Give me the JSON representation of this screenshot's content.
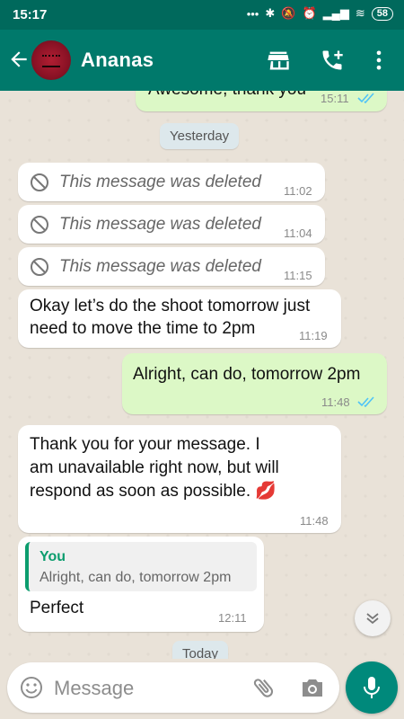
{
  "status_bar": {
    "time": "15:17",
    "battery": "58"
  },
  "header": {
    "contact_name": "Ananas"
  },
  "date_chips": {
    "yesterday": "Yesterday",
    "today": "Today"
  },
  "messages": [
    {
      "dir": "out",
      "text": "Awesome, thank you",
      "time": "15:11"
    },
    {
      "dir": "in",
      "deleted": true,
      "text": "This message was deleted",
      "time": "11:02"
    },
    {
      "dir": "in",
      "deleted": true,
      "text": "This message was deleted",
      "time": "11:04"
    },
    {
      "dir": "in",
      "deleted": true,
      "text": "This message was deleted",
      "time": "11:15"
    },
    {
      "dir": "in",
      "line1": "Okay let’s do the shoot tomorrow just",
      "line2": "need to move the time to 2pm",
      "time": "11:19"
    },
    {
      "dir": "out",
      "text": "Alright, can do, tomorrow 2pm",
      "time": "11:48"
    },
    {
      "dir": "in",
      "line1": "Thank you for your message. I",
      "line2": "am unavailable right now, but will",
      "line3": "respond as soon as possible. 💋",
      "time": "11:48"
    },
    {
      "dir": "in",
      "reply_author": "You",
      "reply_text": "Alright, can do, tomorrow 2pm",
      "text": "Perfect",
      "time": "12:11"
    }
  ],
  "composer": {
    "placeholder": "Message"
  },
  "colors": {
    "header": "#00796b",
    "status_bar": "#00695c",
    "outgoing_bubble": "#dcf8c6",
    "read_ticks": "#4fc3f7",
    "reply_accent": "#0c9d6e"
  },
  "icons": [
    "back-arrow-icon",
    "shop-icon",
    "add-call-icon",
    "more-vert-icon",
    "deleted-icon",
    "double-check-icon",
    "chevron-down-icon",
    "emoji-icon",
    "attach-icon",
    "camera-icon",
    "mic-icon"
  ]
}
